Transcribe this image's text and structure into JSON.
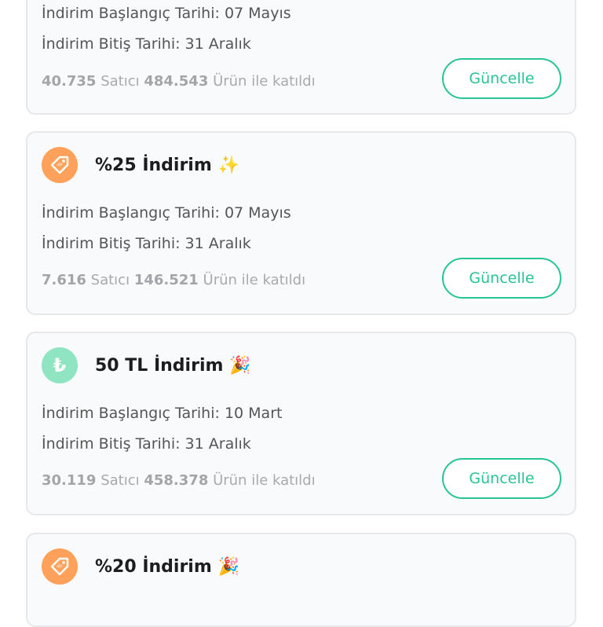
{
  "colors": {
    "accent": "#27c593",
    "orange_badge": "#ffa15a",
    "green_badge": "#8fe5c2"
  },
  "cards": [
    {
      "icon": "tag-icon",
      "title": "",
      "emoji": "",
      "start_label": "İndirim Başlangıç Tarihi: 07 Mayıs",
      "end_label": "İndirim Bitiş Tarihi: 31 Aralık",
      "sellers": "40.735",
      "sellers_label": "Satıcı",
      "products": "484.543",
      "products_label": "Ürün ile katıldı",
      "button": "Güncelle"
    },
    {
      "icon": "tag-icon",
      "title": "%25 İndirim",
      "emoji": "✨",
      "start_label": "İndirim Başlangıç Tarihi: 07 Mayıs",
      "end_label": "İndirim Bitiş Tarihi: 31 Aralık",
      "sellers": "7.616",
      "sellers_label": "Satıcı",
      "products": "146.521",
      "products_label": "Ürün ile katıldı",
      "button": "Güncelle"
    },
    {
      "icon": "lira-icon",
      "icon_glyph": "₺",
      "title": "50 TL İndirim",
      "emoji": "🎉",
      "start_label": "İndirim Başlangıç Tarihi: 10 Mart",
      "end_label": "İndirim Bitiş Tarihi: 31 Aralık",
      "sellers": "30.119",
      "sellers_label": "Satıcı",
      "products": "458.378",
      "products_label": "Ürün ile katıldı",
      "button": "Güncelle"
    },
    {
      "icon": "tag-icon",
      "title": "%20 İndirim",
      "emoji": "🎉"
    }
  ]
}
